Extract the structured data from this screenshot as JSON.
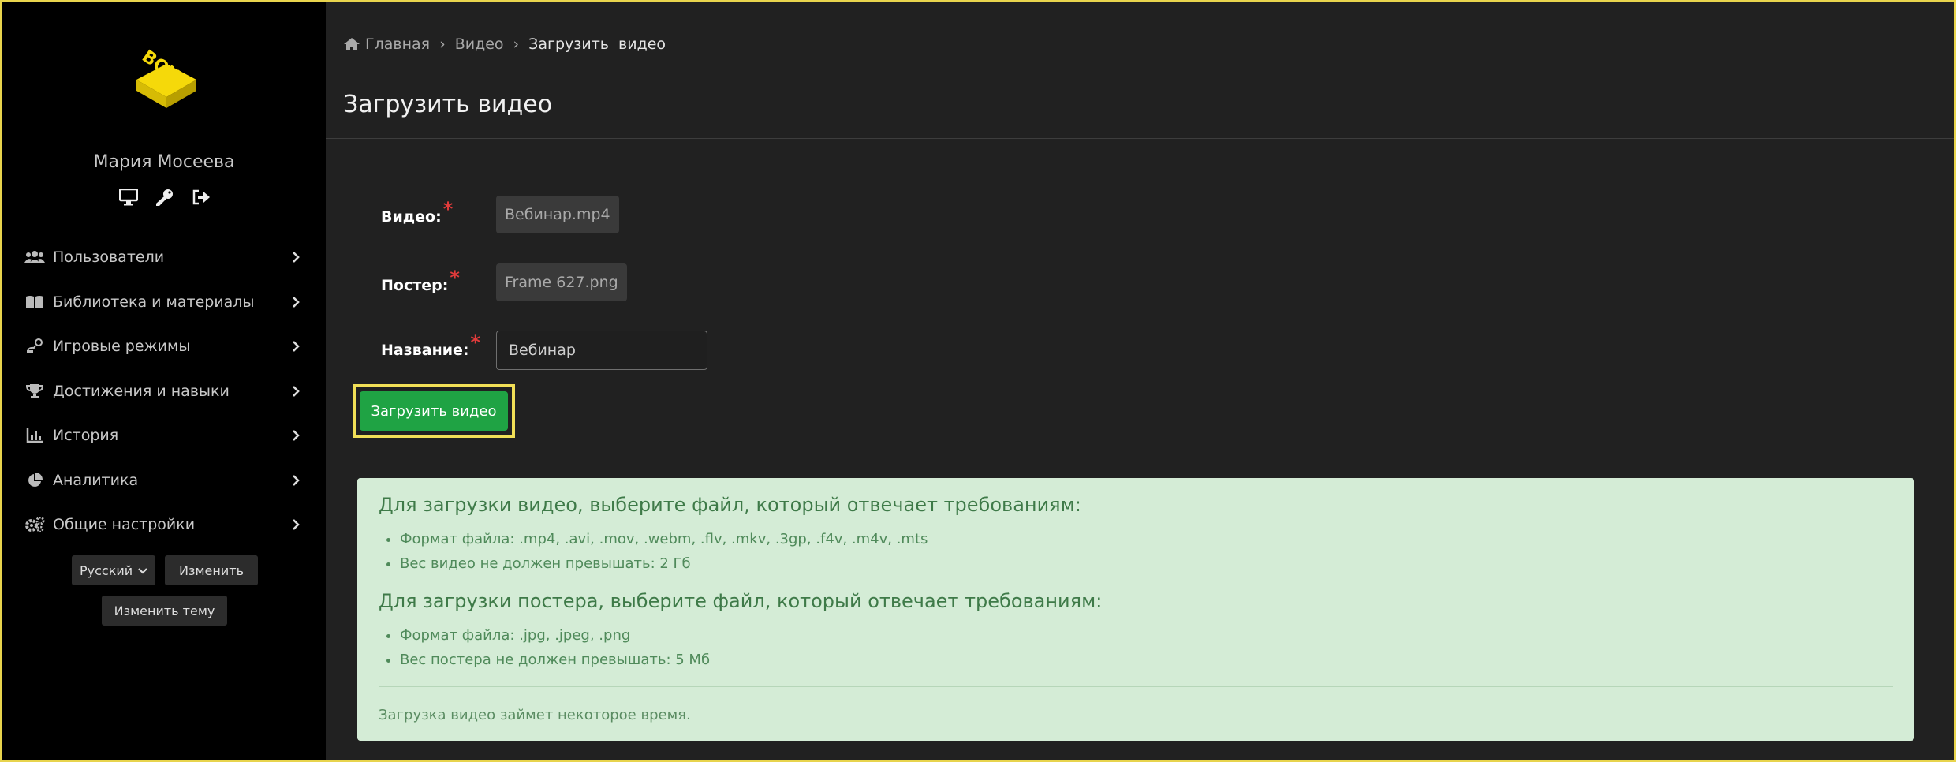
{
  "sidebar": {
    "logo_text": "BOX BATTLE",
    "user_name": "Мария Мосеева",
    "user_icons": [
      "monitor-icon",
      "key-icon",
      "logout-icon"
    ],
    "items": [
      {
        "icon": "users-icon",
        "label": "Пользователи"
      },
      {
        "icon": "book-icon",
        "label": "Библиотека и материалы"
      },
      {
        "icon": "game-modes-icon",
        "label": "Игровые режимы"
      },
      {
        "icon": "trophy-icon",
        "label": "Достижения и навыки"
      },
      {
        "icon": "chart-icon",
        "label": "История"
      },
      {
        "icon": "pie-chart-icon",
        "label": "Аналитика"
      },
      {
        "icon": "gears-icon",
        "label": "Общие настройки"
      }
    ],
    "language": {
      "selected": "Русский",
      "change_label": "Изменить"
    },
    "theme_label": "Изменить тему"
  },
  "breadcrumb": {
    "home": "Главная",
    "video": "Видео",
    "current": "Загрузить  видео"
  },
  "page_title": "Загрузить видео",
  "form": {
    "video_label": "Видео:",
    "video_value": "Вебинар.mp4",
    "poster_label": "Постер:",
    "poster_value": "Frame 627.png",
    "name_label": "Название:",
    "name_value": "Вебинар",
    "required_mark": "*",
    "submit_label": "Загрузить видео"
  },
  "info": {
    "video_heading": "Для загрузки видео, выберите файл, который отвечает требованиям:",
    "video_rules": [
      "Формат файла: .mp4, .avi, .mov, .webm, .flv, .mkv, .3gp, .f4v, .m4v, .mts",
      "Вес видео не должен превышать: 2 Гб"
    ],
    "poster_heading": "Для загрузки постера, выберите файл, который отвечает требованиям:",
    "poster_rules": [
      "Формат файла: .jpg, .jpeg, .png",
      "Вес постера не должен превышать: 5 Мб"
    ],
    "note": "Загрузка видео займет некоторое время."
  },
  "colors": {
    "accent_border": "#e8d44d",
    "submit_green": "#1fa344",
    "info_bg": "#d4ecd6",
    "required_red": "#e23b3b"
  }
}
